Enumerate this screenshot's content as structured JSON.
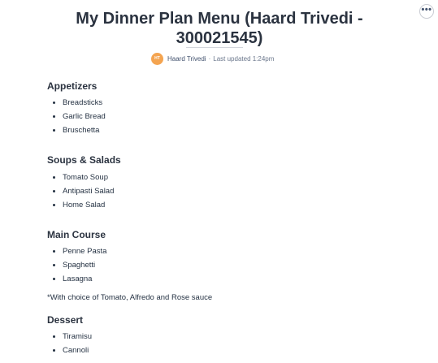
{
  "page": {
    "title": "My Dinner Plan Menu (Haard Trivedi - 300021545)",
    "more_label": "•••"
  },
  "byline": {
    "avatar_initials": "HT",
    "author": "Haard Trivedi",
    "separator": "·",
    "updated": "Last updated 1:24pm"
  },
  "sections": [
    {
      "heading": "Appetizers",
      "items": [
        "Breadsticks",
        "Garlic Bread",
        "Bruschetta"
      ]
    },
    {
      "heading": "Soups & Salads",
      "items": [
        "Tomato Soup",
        "Antipasti Salad",
        "Home Salad"
      ]
    },
    {
      "heading": "Main Course",
      "items": [
        "Penne Pasta",
        "Spaghetti",
        "Lasagna"
      ],
      "note": "*With choice of Tomato, Alfredo and Rose sauce"
    },
    {
      "heading": "Dessert",
      "items": [
        "Tiramisu",
        "Cannoli"
      ]
    }
  ]
}
